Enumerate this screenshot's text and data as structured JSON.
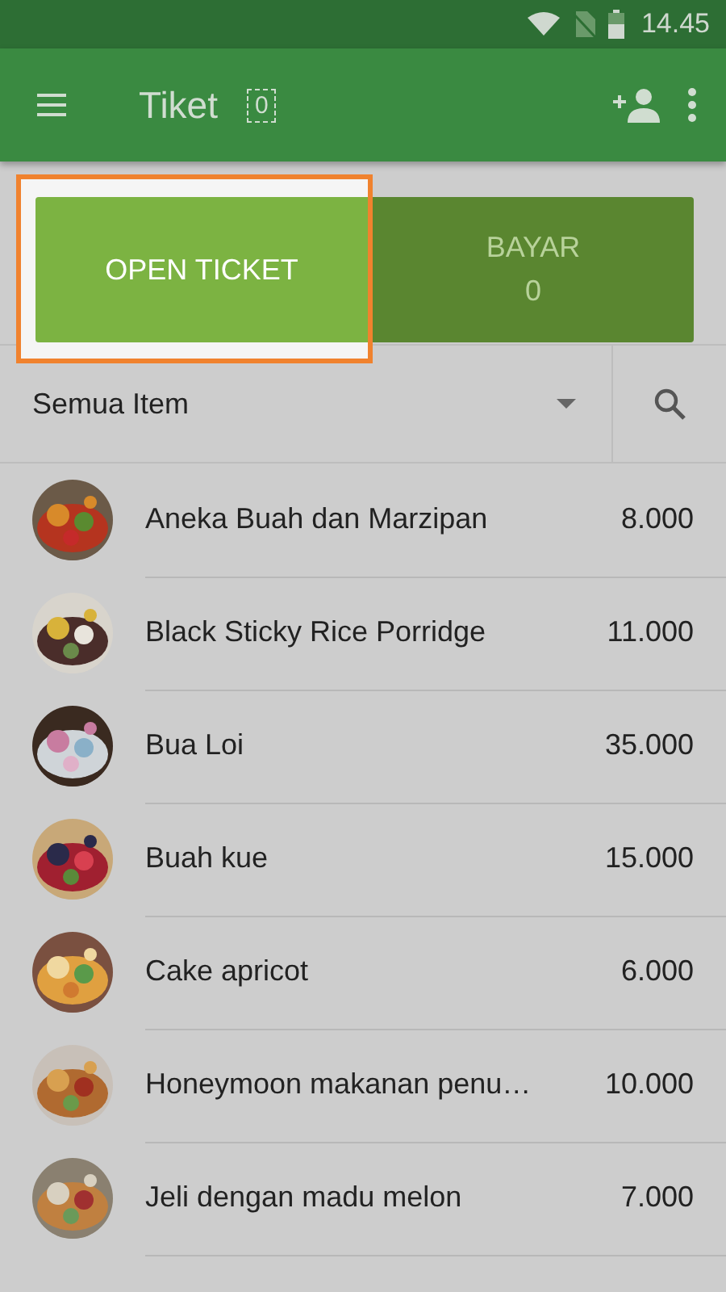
{
  "status_bar": {
    "time": "14.45"
  },
  "app_bar": {
    "title": "Tiket",
    "ticket_count": "0"
  },
  "actions": {
    "open_ticket": {
      "label": "OPEN TICKET",
      "highlighted": true
    },
    "pay": {
      "label": "BAYAR",
      "amount": "0",
      "disabled": true
    }
  },
  "filter": {
    "category": "Semua Item"
  },
  "items": [
    {
      "name": "Aneka Buah dan Marzipan",
      "price": "8.000",
      "kind": "picture"
    },
    {
      "name": "Black Sticky Rice Porridge",
      "price": "11.000",
      "kind": "picture"
    },
    {
      "name": "Bua Loi",
      "price": "35.000",
      "kind": "picture"
    },
    {
      "name": "Buah kue",
      "price": "15.000",
      "kind": "picture"
    },
    {
      "name": "Cake apricot",
      "price": "6.000",
      "kind": "picture"
    },
    {
      "name": "Honeymoon makanan penu…",
      "price": "10.000",
      "kind": "picture"
    },
    {
      "name": "Jeli dengan madu melon",
      "price": "7.000",
      "kind": "picture"
    }
  ]
}
